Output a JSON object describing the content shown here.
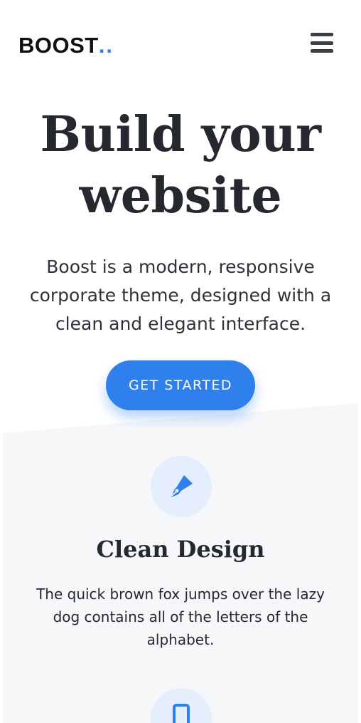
{
  "brand": {
    "name": "BOOST",
    "dots": "..",
    "accent": "#2f80ed"
  },
  "header": {
    "menu_icon": "hamburger-menu-icon"
  },
  "hero": {
    "title_line1": "Build your",
    "title_line2": "website",
    "subtitle": "Boost is a modern, responsive corporate theme, designed with a clean and elegant interface.",
    "cta_label": "GET STARTED"
  },
  "features": [
    {
      "icon": "pen-nib-icon",
      "title": "Clean Design",
      "text": "The quick brown fox jumps over the lazy dog contains all of the letters of the alphabet."
    },
    {
      "icon": "mobile-phone-icon"
    }
  ],
  "colors": {
    "primary": "#2f80ed",
    "text": "#25282e",
    "feature_bg": "#f6f7f9",
    "icon_circle_bg": "#e4eefc"
  }
}
